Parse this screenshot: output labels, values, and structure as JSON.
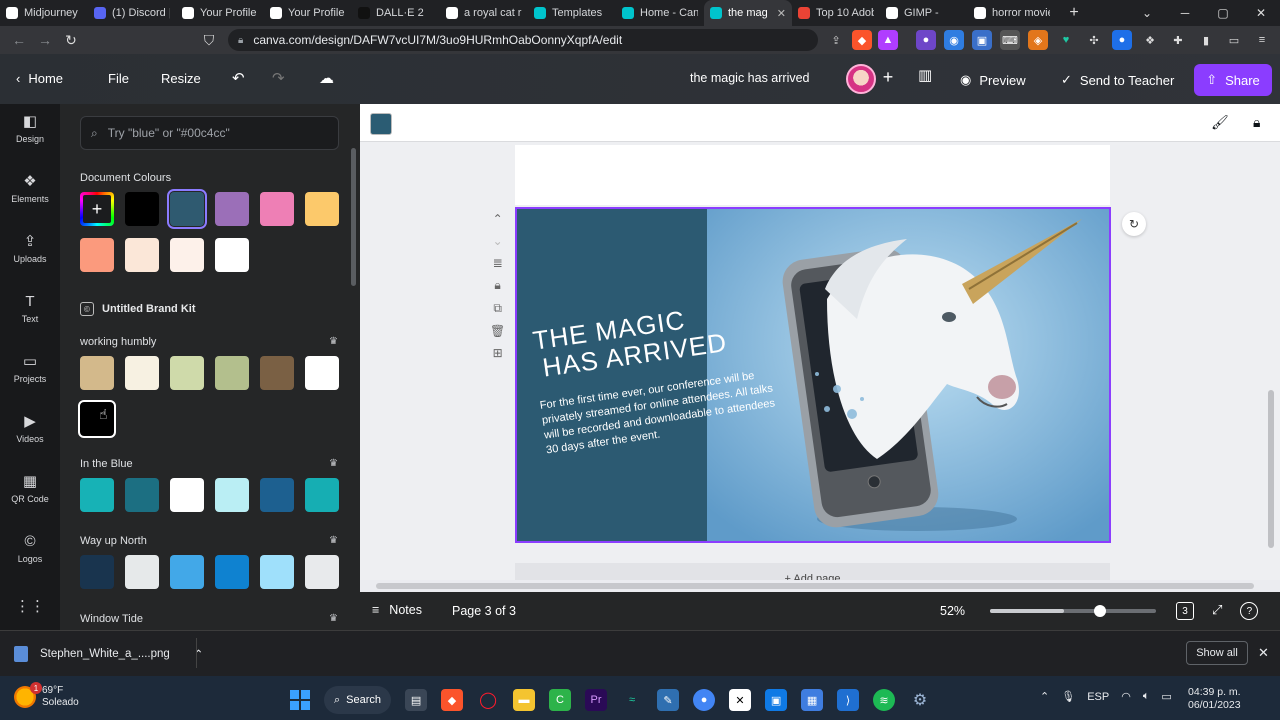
{
  "browser": {
    "tabs": [
      {
        "label": "Midjourney",
        "color": "#ffffff",
        "active": false
      },
      {
        "label": "(1) Discord |",
        "color": "#5865f2",
        "active": false
      },
      {
        "label": "Your Profile",
        "color": "#ffffff",
        "active": false
      },
      {
        "label": "Your Profile",
        "color": "#ffffff",
        "active": false
      },
      {
        "label": "DALL·E 2",
        "color": "#111111",
        "active": false
      },
      {
        "label": "a royal cat r",
        "color": "#ffffff",
        "active": false
      },
      {
        "label": "Templates",
        "color": "#00c4cc",
        "active": false
      },
      {
        "label": "Home - Canv",
        "color": "#00c4cc",
        "active": false
      },
      {
        "label": "the mag",
        "color": "#00c4cc",
        "active": true
      },
      {
        "label": "Top 10 Adob",
        "color": "#ea4335",
        "active": false
      },
      {
        "label": "GIMP - ",
        "color": "#ffffff",
        "active": false
      },
      {
        "label": "horror movie",
        "color": "#ffffff",
        "active": false
      }
    ],
    "tab_close": "✕",
    "new_tab": "+",
    "url": "canva.com/design/DAFW7vcUI7M/3uo9HURmhOabOonnyXqpfA/edit"
  },
  "canva_header": {
    "home": "Home",
    "file": "File",
    "resize": "Resize",
    "doc_title": "the magic has arrived",
    "plus": "+",
    "preview": "Preview",
    "send_to_teacher": "Send to Teacher",
    "share": "Share"
  },
  "rail": [
    {
      "label": "Design",
      "icon": "◧"
    },
    {
      "label": "Elements",
      "icon": "❖"
    },
    {
      "label": "Uploads",
      "icon": "⇪"
    },
    {
      "label": "Text",
      "icon": "T"
    },
    {
      "label": "Projects",
      "icon": "▭"
    },
    {
      "label": "Videos",
      "icon": "▶"
    },
    {
      "label": "QR Code",
      "icon": "▦"
    },
    {
      "label": "Logos",
      "icon": "©"
    },
    {
      "label": "",
      "icon": "⋮⋮"
    }
  ],
  "panel": {
    "search_placeholder": "Try \"blue\" or \"#00c4cc\"",
    "document_colours_title": "Document Colours",
    "document_colours": [
      "#000000",
      "#2f5a70",
      "#9b6fb8",
      "#ee7fb5",
      "#fcc96b",
      "#fb9a7d",
      "#fbe7d8",
      "#fdf1ea",
      "#ffffff"
    ],
    "brand_kit": "Untitled Brand Kit",
    "palettes": [
      {
        "name": "working humbly",
        "colors": [
          "#d3b98b",
          "#f7f1e2",
          "#cfdaaa",
          "#b3bf8d",
          "#7a6044",
          "#ffffff",
          "#000000"
        ]
      },
      {
        "name": "In the Blue",
        "colors": [
          "#17b2b6",
          "#1c6f82",
          "#ffffff",
          "#baeef4",
          "#1d6090",
          "#16aeb3"
        ]
      },
      {
        "name": "Way up North",
        "colors": [
          "#19344e",
          "#e6e9ea",
          "#42a8e8",
          "#0f82d0",
          "#9fe0fb",
          "#e8eaec"
        ]
      },
      {
        "name": "Window Tide",
        "colors": []
      }
    ]
  },
  "design": {
    "headline_line1": "THE MAGIC",
    "headline_line2": "HAS ARRIVED",
    "body": "For the first time ever, our conference will be privately streamed for online attendees. All talks will be recorded and downloadable to attendees 30 days after the event.",
    "add_page": "+ Add page",
    "left_pane_color": "#2c5a72"
  },
  "footer": {
    "notes": "Notes",
    "page_info": "Page 3 of 3",
    "zoom": "52%",
    "zoom_level": 0.52,
    "page_count": "3",
    "help": "?"
  },
  "download": {
    "filename": "Stephen_White_a_....png",
    "show_all": "Show all",
    "close": "✕"
  },
  "taskbar": {
    "temp": "69°F",
    "weather": "Soleado",
    "badge": "1",
    "search": "Search",
    "lang": "ESP",
    "time": "04:39 p. m.",
    "date": "06/01/2023"
  }
}
